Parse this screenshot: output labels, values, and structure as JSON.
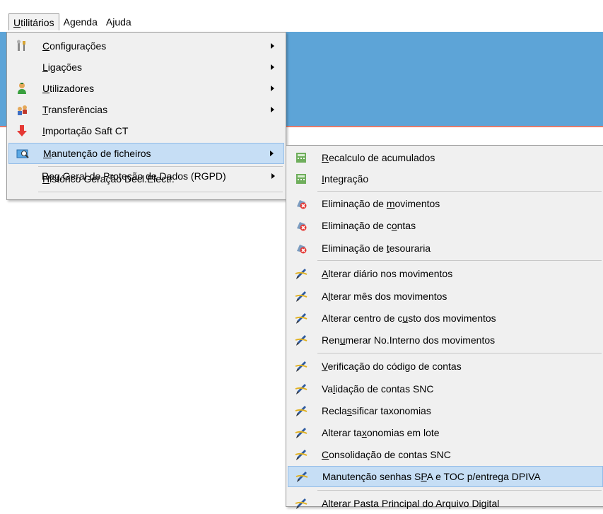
{
  "menubar": {
    "items": [
      {
        "label_pre": "",
        "label_ul": "U",
        "label_post": "tilitários"
      },
      {
        "label_pre": "A",
        "label_ul": "g",
        "label_post": "enda"
      },
      {
        "label_pre": "A",
        "label_ul": "j",
        "label_post": "uda"
      }
    ]
  },
  "utilitarios_menu": {
    "items": [
      {
        "pre": "",
        "ul": "C",
        "post": "onfigurações",
        "icon": "settings-tools-icon"
      },
      {
        "pre": "",
        "ul": "L",
        "post": "igações",
        "icon": ""
      },
      {
        "pre": "",
        "ul": "U",
        "post": "tilizadores",
        "icon": "user-icon"
      },
      {
        "pre": "",
        "ul": "T",
        "post": "ransferências",
        "icon": "transfer-icon"
      },
      {
        "pre": "",
        "ul": "I",
        "post": "mportação Saft CT",
        "icon": "down-arrow-icon"
      },
      {
        "pre": "",
        "ul": "M",
        "post": "anutenção de ficheiros",
        "icon": "file-maintenance-icon"
      },
      {
        "pre": "",
        "ul": "H",
        "post": "istórico Geração Decl.Electr.",
        "icon": ""
      },
      {
        "pre": "Reg.Geral de Proteção de Dados (RGPD)",
        "ul": "",
        "post": "",
        "icon": ""
      }
    ]
  },
  "manutencao_menu": {
    "items": [
      {
        "pre": "",
        "ul": "R",
        "post": "ecalculo de acumulados",
        "icon": "calculator-icon"
      },
      {
        "pre": "",
        "ul": "I",
        "post": "ntegração",
        "icon": "calculator-icon"
      },
      {
        "pre": "Eliminação de ",
        "ul": "m",
        "post": "ovimentos",
        "icon": "delete-icon"
      },
      {
        "pre": "Eliminação de c",
        "ul": "o",
        "post": "ntas",
        "icon": "delete-icon"
      },
      {
        "pre": "Eliminação de ",
        "ul": "t",
        "post": "esouraria",
        "icon": "delete-icon"
      },
      {
        "pre": "",
        "ul": "A",
        "post": "lterar diário nos movimentos",
        "icon": "edit-pen-icon"
      },
      {
        "pre": "A",
        "ul": "l",
        "post": "terar mês dos movimentos",
        "icon": "edit-pen-icon"
      },
      {
        "pre": "Alterar centro de c",
        "ul": "u",
        "post": "sto dos movimentos",
        "icon": "edit-pen-icon"
      },
      {
        "pre": "Ren",
        "ul": "u",
        "post": "merar No.Interno dos movimentos",
        "icon": "edit-pen-icon"
      },
      {
        "pre": "",
        "ul": "V",
        "post": "erificação do código de contas",
        "icon": "edit-pen-icon"
      },
      {
        "pre": "Va",
        "ul": "l",
        "post": "idação de contas SNC",
        "icon": "edit-pen-icon"
      },
      {
        "pre": "Recla",
        "ul": "s",
        "post": "sificar taxonomias",
        "icon": "edit-pen-icon"
      },
      {
        "pre": "Alterar ta",
        "ul": "x",
        "post": "onomias em lote",
        "icon": "edit-pen-icon"
      },
      {
        "pre": "",
        "ul": "C",
        "post": "onsolidação de contas SNC",
        "icon": "edit-pen-icon"
      },
      {
        "pre": "Manutenção senhas S",
        "ul": "P",
        "post": "A e TOC p/entrega DPIVA",
        "icon": "edit-pen-icon"
      },
      {
        "pre": "Alterar Pasta Principal do Arquivo Digital",
        "ul": "",
        "post": "",
        "icon": "edit-pen-icon"
      }
    ]
  },
  "colors": {
    "accent_band": "#5da4d7",
    "highlight": "#c6def5"
  }
}
